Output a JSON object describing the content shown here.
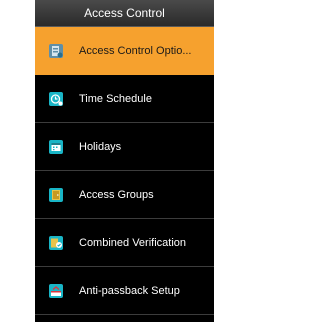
{
  "header": {
    "title": "Access Control"
  },
  "menu": {
    "items": [
      {
        "label": "Access Control Optio...",
        "icon": "access-control-options-icon",
        "selected": true
      },
      {
        "label": "Time Schedule",
        "icon": "time-schedule-icon",
        "selected": false
      },
      {
        "label": "Holidays",
        "icon": "holidays-icon",
        "selected": false
      },
      {
        "label": "Access Groups",
        "icon": "access-groups-icon",
        "selected": false
      },
      {
        "label": "Combined Verification",
        "icon": "combined-verification-icon",
        "selected": false
      },
      {
        "label": "Anti-passback Setup",
        "icon": "anti-passback-icon",
        "selected": false
      }
    ]
  },
  "colors": {
    "selected_bg": "#f6a12e",
    "background": "#000000",
    "icon_teal": "#19b5c6"
  }
}
